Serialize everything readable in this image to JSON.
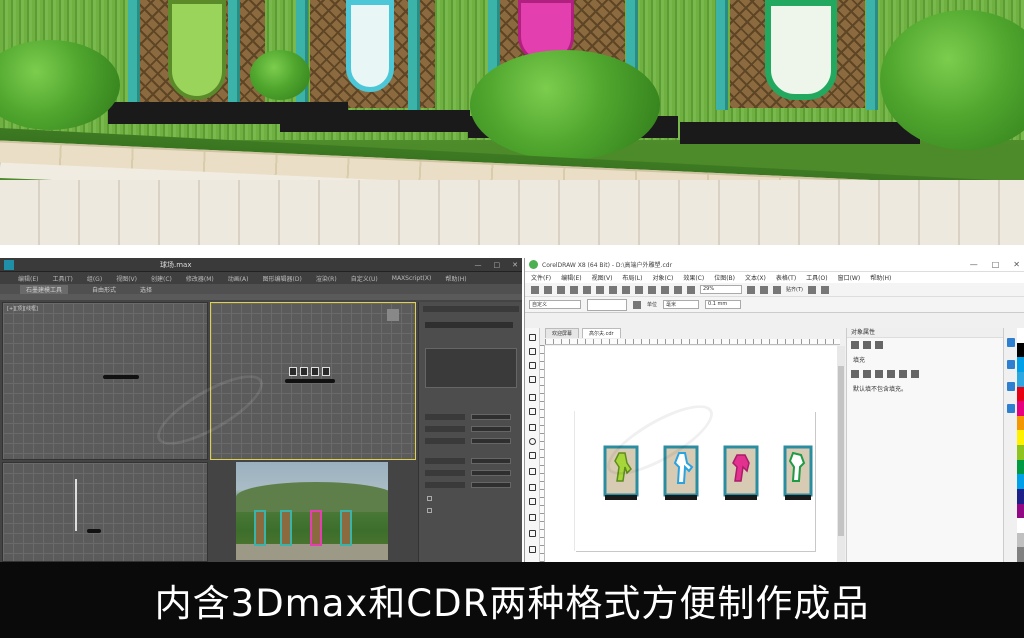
{
  "scene": {
    "sign_colors": [
      "#9bd45a",
      "#4cc7d8",
      "#e43fae",
      "#23a860"
    ],
    "post_color": "#3bb3a8"
  },
  "max_window": {
    "title": "球场.max",
    "menu": [
      "编辑(E)",
      "工具(T)",
      "组(G)",
      "视图(V)",
      "创建(C)",
      "修改器(M)",
      "动画(A)",
      "图形编辑器(D)",
      "渲染(R)",
      "自定义(U)",
      "MAXScript(X)",
      "帮助(H)"
    ],
    "ribbon": [
      "石墨建模工具",
      "自由形式",
      "选择"
    ],
    "command_panel_checkboxes": [
      "",
      ""
    ],
    "viewport_label": "[+][顶][线框]"
  },
  "cdr_window": {
    "title": "CorelDRAW X8 (64 Bit) - D:\\高端户外雕塑.cdr",
    "menu": [
      "文件(F)",
      "编辑(E)",
      "视图(V)",
      "布局(L)",
      "对象(C)",
      "效果(C)",
      "位图(B)",
      "文本(X)",
      "表格(T)",
      "工具(O)",
      "窗口(W)",
      "帮助(H)"
    ],
    "zoom": "29%",
    "snap_label": "贴齐(T)",
    "preset": "自定义",
    "units": "毫米",
    "nudge": "0.1 mm",
    "tabs": [
      "欢迎屏幕",
      "高尔夫.cdr"
    ],
    "props_header": "对象属性",
    "props_fill": "填充",
    "props_note": "默认填不包含填充。",
    "sign_colors": [
      "#a6d63a",
      "#2aa3e0",
      "#e2318f",
      "#1f9a45"
    ],
    "palette": [
      "#ffffff",
      "#000000",
      "#00a0e9",
      "#2ea7e0",
      "#e60012",
      "#e4007f",
      "#f39800",
      "#fff100",
      "#8fc31f",
      "#009944",
      "#00a0e9",
      "#1d2088",
      "#920783",
      "#ffffff",
      "#c0c0c0",
      "#808080"
    ]
  },
  "caption": "内含3Dmax和CDR两种格式方便制作成品"
}
